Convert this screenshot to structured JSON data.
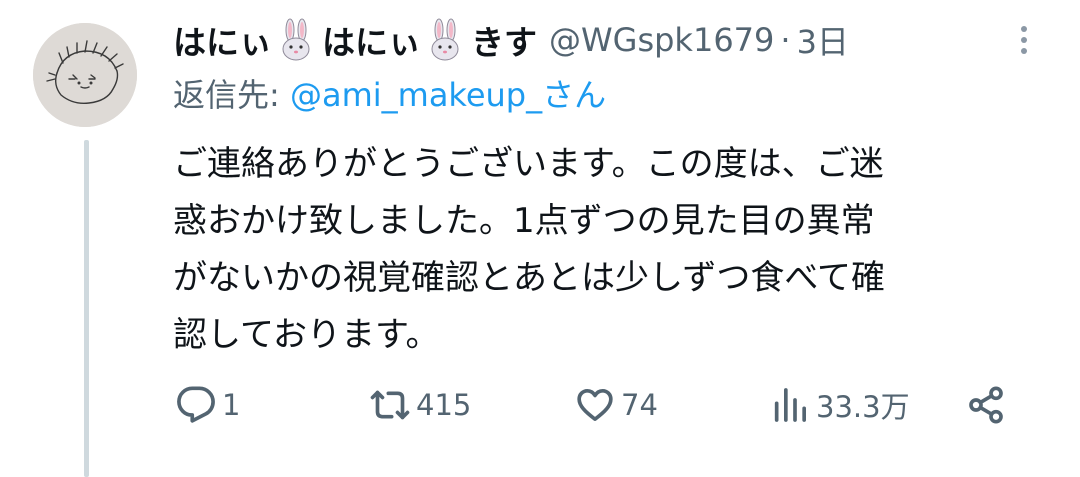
{
  "tweet": {
    "display_name_part1": "はにぃ",
    "display_name_part2": "はにぃ",
    "display_name_part3": "きす",
    "handle": "@WGspk1679",
    "separator": "·",
    "time": "3日",
    "reply_label": "返信先:",
    "reply_to_handle": "@ami_makeup_さん",
    "text": "ご連絡ありがとうございます。この度は、ご迷\n惑おかけ致しました。1点ずつの見た目の異常\nがないかの視覚確認とあとは少しずつ食べて確\n認しております。"
  },
  "actions": {
    "reply_count": "1",
    "retweet_count": "415",
    "like_count": "74",
    "views_count": "33.3万"
  },
  "icons": {
    "avatar": "hedgehog-sketch-avatar",
    "name_emoji": "rabbit-icon",
    "more": "more-vertical-icon",
    "reply": "reply-icon",
    "retweet": "retweet-icon",
    "like": "heart-icon",
    "views": "views-icon",
    "share": "share-icon"
  },
  "colors": {
    "text": "#0f1419",
    "muted": "#536471",
    "link": "#1d9bf0",
    "thread_line": "#cfd9de"
  }
}
